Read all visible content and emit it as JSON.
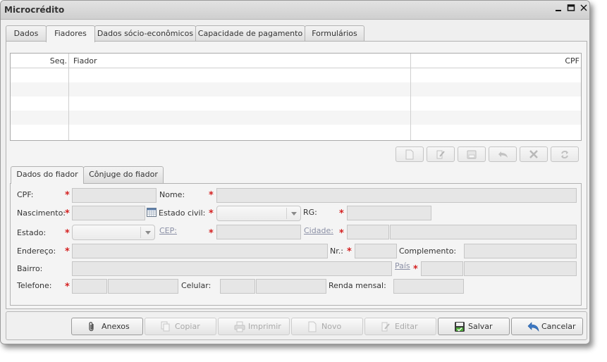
{
  "window": {
    "title": "Microcrédito"
  },
  "tabs": [
    "Dados",
    "Fiadores",
    "Dados sócio-econômicos",
    "Capacidade de pagamento",
    "Formulários"
  ],
  "grid": {
    "columns": [
      "Seq.",
      "Fiador",
      "CPF"
    ]
  },
  "subtabs": [
    "Dados do fiador",
    "Cônjuge do fiador"
  ],
  "form": {
    "cpf": "CPF:",
    "nome": "Nome:",
    "nascimento": "Nascimento:",
    "estado_civil": "Estado civil:",
    "rg": "RG:",
    "estado": "Estado:",
    "cep": "CEP:",
    "cidade": "Cidade:",
    "endereco": "Endereço:",
    "nr": "Nr.:",
    "complemento": "Complemento:",
    "bairro": "Bairro:",
    "pais": "País",
    "telefone": "Telefone:",
    "celular": "Celular:",
    "renda": "Renda mensal:"
  },
  "buttons": {
    "anexos": "Anexos",
    "copiar": "Copiar",
    "imprimir": "Imprimir",
    "novo": "Novo",
    "editar": "Editar",
    "salvar": "Salvar",
    "cancelar": "Cancelar"
  },
  "required_mark": "*",
  "colors": {
    "required": "#d42020",
    "link": "#8a8fa5"
  }
}
